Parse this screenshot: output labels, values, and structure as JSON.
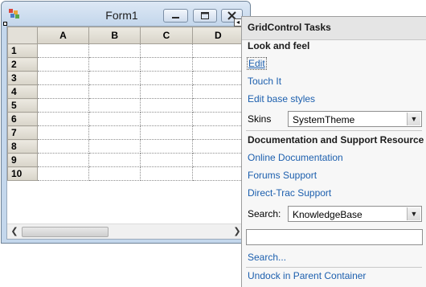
{
  "form": {
    "title": "Form1"
  },
  "grid": {
    "columns": [
      "A",
      "B",
      "C",
      "D"
    ],
    "rows": [
      "1",
      "2",
      "3",
      "4",
      "5",
      "6",
      "7",
      "8",
      "9",
      "10"
    ]
  },
  "panel": {
    "title": "GridControl Tasks",
    "look_and_feel": {
      "heading": "Look and feel",
      "edit": "Edit",
      "touch_it": "Touch It",
      "edit_base_styles": "Edit base styles",
      "skins_label": "Skins",
      "skins_value": "SystemTheme"
    },
    "documentation": {
      "heading": "Documentation and Support Resource",
      "online_documentation": "Online Documentation",
      "forums_support": "Forums Support",
      "direct_trac_support": "Direct-Trac Support",
      "search_label": "Search:",
      "search_value": "KnowledgeBase",
      "search_text": "",
      "search_link": "Search..."
    },
    "undock": "Undock in Parent Container"
  },
  "icons": {
    "minimize": "minimize-icon",
    "maximize": "maximize-icon",
    "close": "close-icon",
    "dropdown": "chevron-down-icon",
    "scroll_left": "scroll-left-icon",
    "scroll_right": "scroll-right-icon"
  }
}
